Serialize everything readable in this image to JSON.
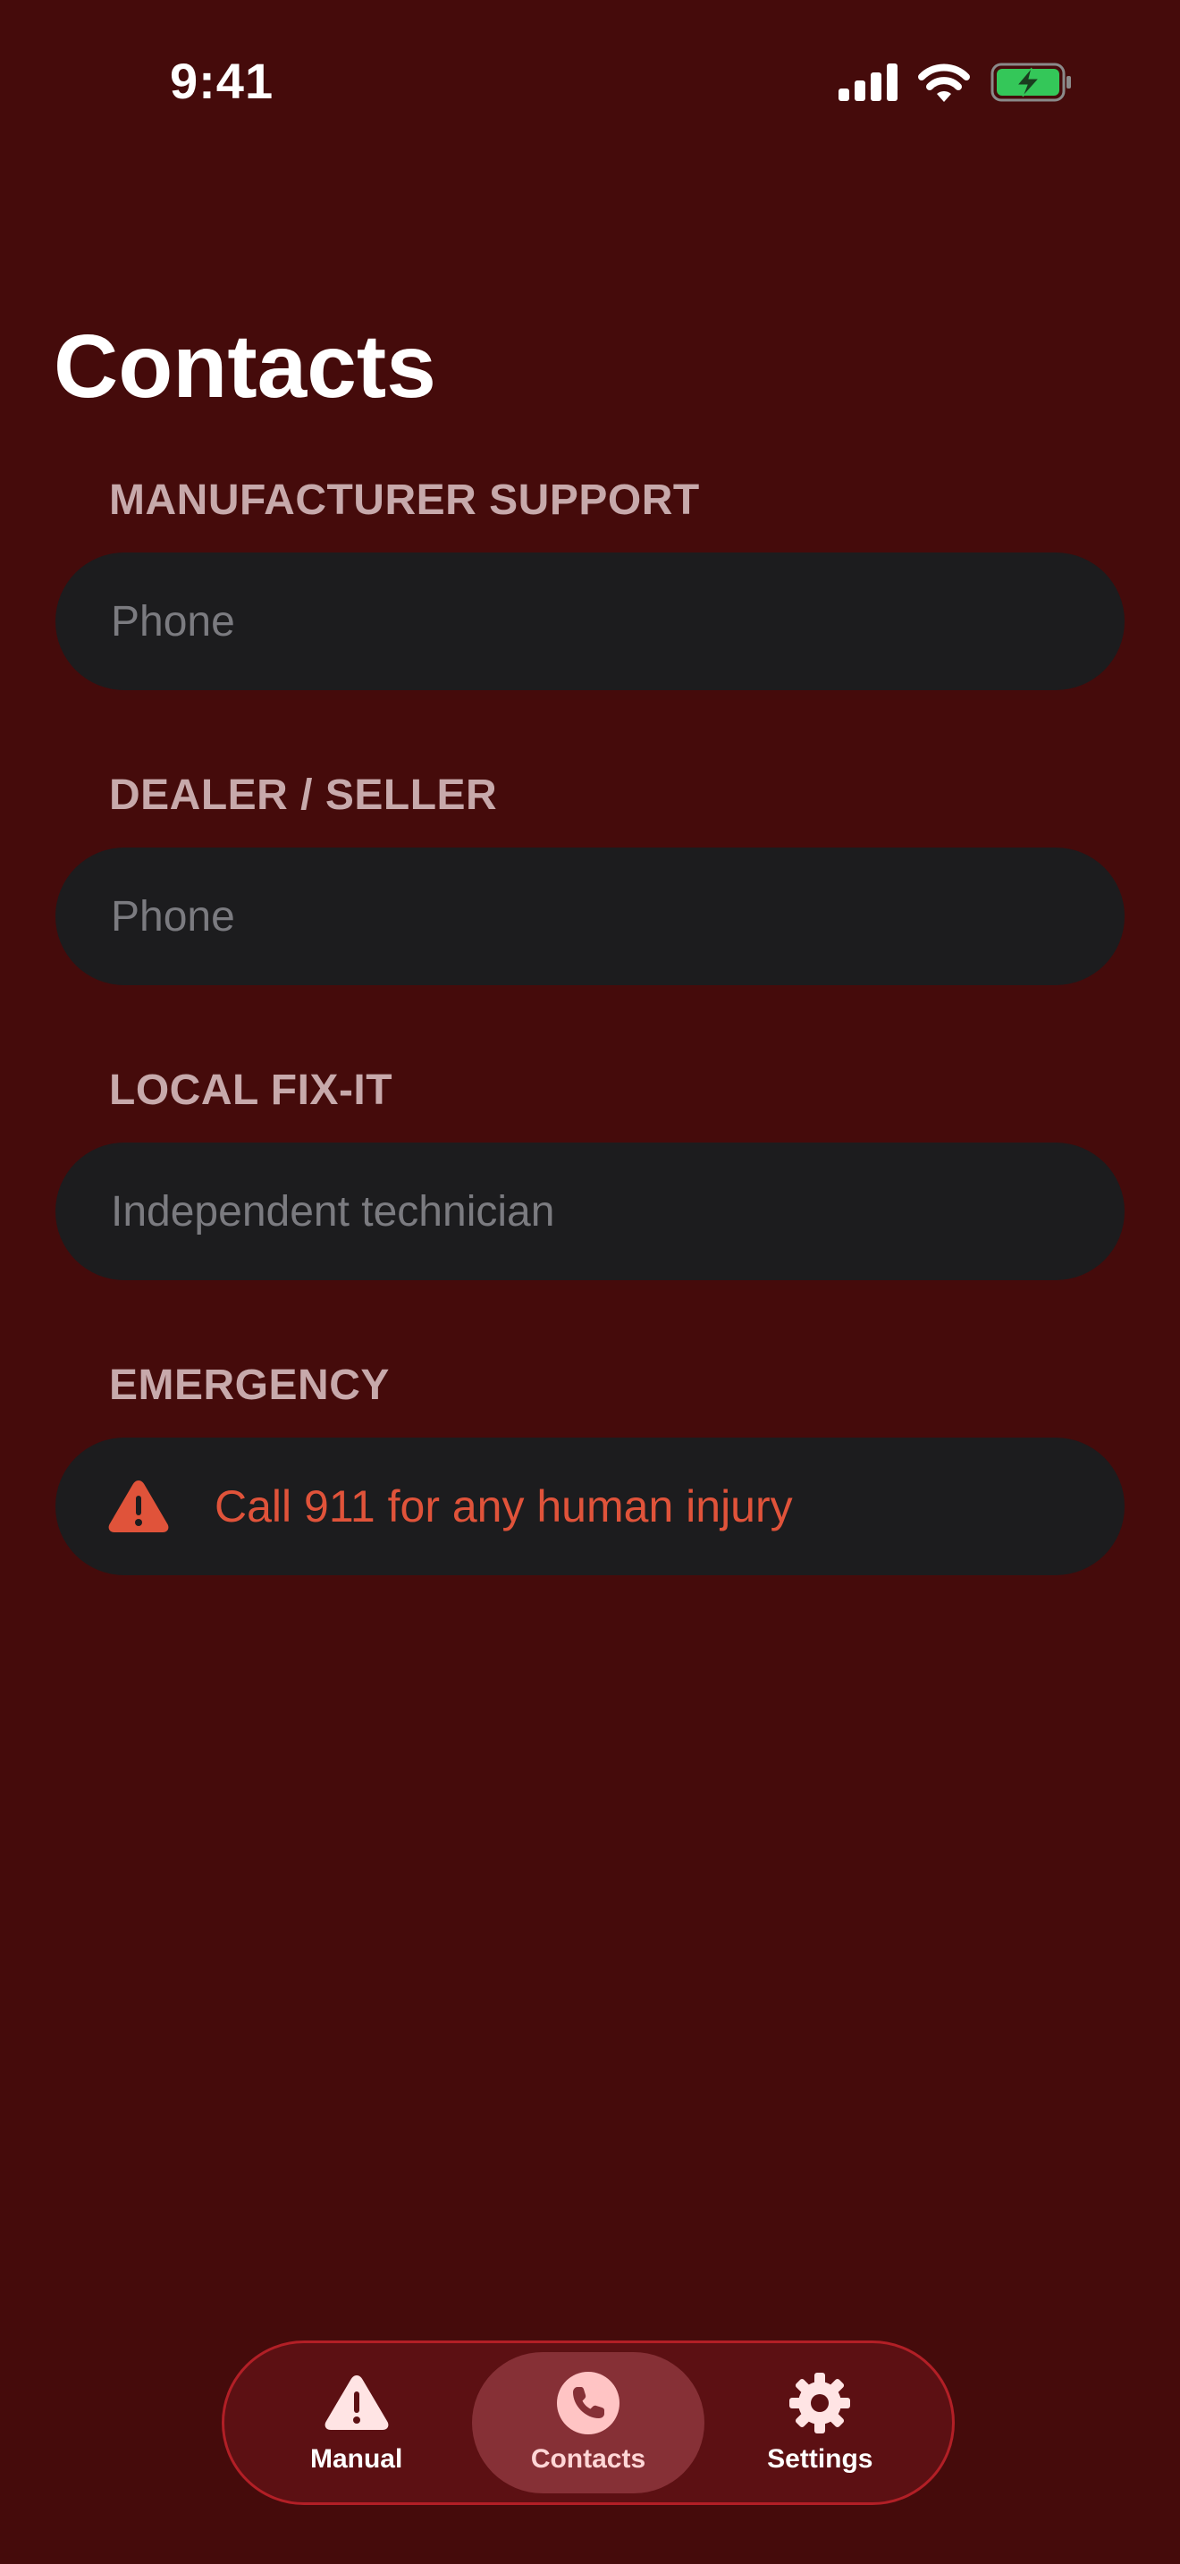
{
  "status_bar": {
    "time": "9:41"
  },
  "page": {
    "title": "Contacts"
  },
  "sections": [
    {
      "header": "MANUFACTURER SUPPORT",
      "field_value": "",
      "placeholder": "Phone"
    },
    {
      "header": "DEALER / SELLER",
      "field_value": "",
      "placeholder": "Phone"
    },
    {
      "header": "LOCAL FIX-IT",
      "field_value": "",
      "placeholder": "Independent technician"
    }
  ],
  "emergency": {
    "header": "EMERGENCY",
    "text": "Call 911 for any human injury",
    "icon": "warning-triangle-icon",
    "color": "#e0533a"
  },
  "tab_bar": {
    "tabs": [
      {
        "label": "Manual",
        "icon": "warning-triangle-icon",
        "active": false
      },
      {
        "label": "Contacts",
        "icon": "phone-icon",
        "active": true
      },
      {
        "label": "Settings",
        "icon": "gear-icon",
        "active": false
      }
    ]
  },
  "colors": {
    "background": "#450b0b",
    "field_background": "#1c1c1e",
    "section_header": "#c7a9ab",
    "tab_bar_background": "#5c1013",
    "tab_bar_border": "#b21f26",
    "active_tab": "#863036",
    "battery_green": "#34c759"
  }
}
